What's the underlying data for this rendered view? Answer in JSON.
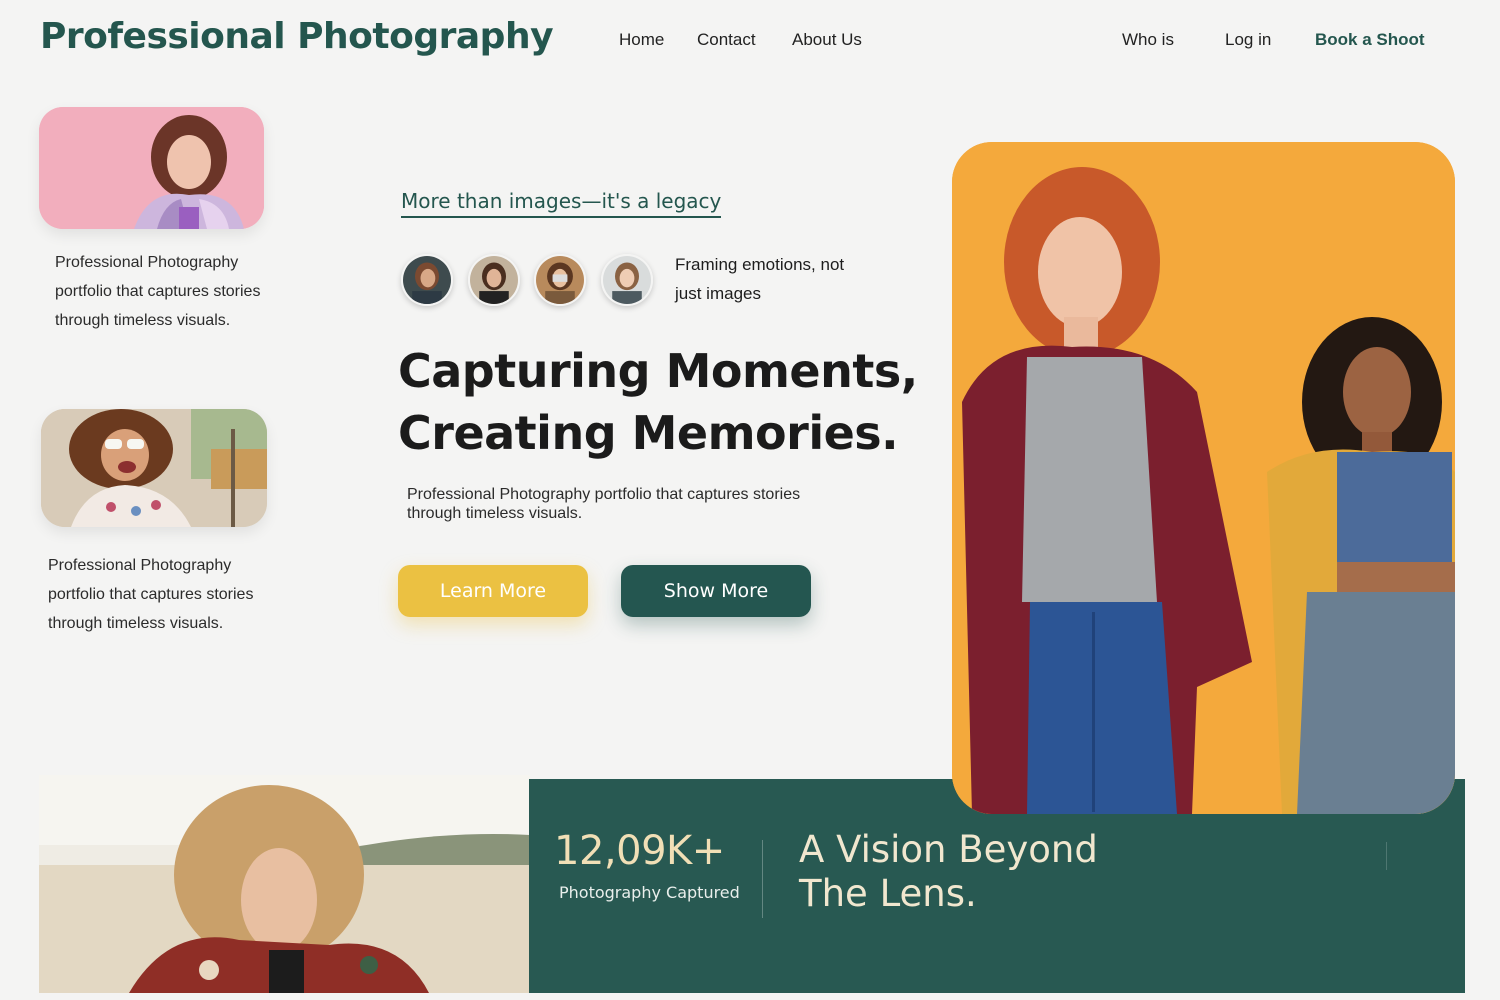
{
  "header": {
    "brand": "Professional Photography",
    "nav": {
      "home": "Home",
      "contact": "Contact",
      "about": "About Us",
      "who": "Who is",
      "login": "Log in",
      "book": "Book a Shoot"
    }
  },
  "left_column": {
    "card_1_text": "Professional Photography portfolio that captures stories through timeless visuals.",
    "card_2_text": "Professional Photography portfolio that captures stories through timeless visuals."
  },
  "hero": {
    "tagline": "More than images—it's a legacy",
    "avatar_caption": "Framing emotions, not just images",
    "headline": "Capturing Moments, Creating Memories.",
    "description": "Professional Photography  portfolio that captures stories through timeless visuals.",
    "learn_more": "Learn More",
    "show_more": "Show More"
  },
  "stats": {
    "number": "12,09K+",
    "label": "Photography Captured",
    "title": "A Vision Beyond The Lens."
  },
  "colors": {
    "brand_green": "#24564e",
    "accent_yellow": "#ebc142",
    "band_green": "#285952",
    "hero_orange": "#f4a93c"
  }
}
